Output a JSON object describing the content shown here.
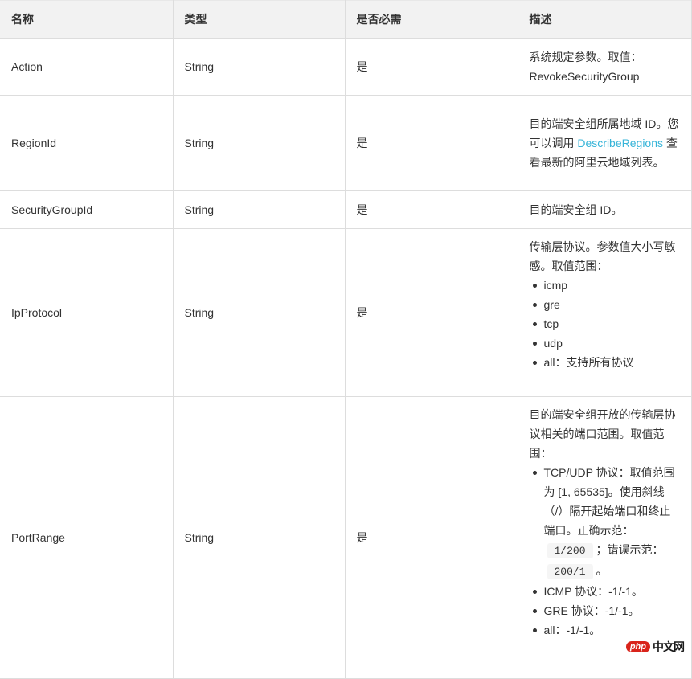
{
  "table": {
    "headers": [
      "名称",
      "类型",
      "是否必需",
      "描述"
    ],
    "rows": [
      {
        "name": "Action",
        "type": "String",
        "required": "是",
        "description": {
          "text": "系统规定参数。取值：RevokeSecurityGroup"
        }
      },
      {
        "name": "RegionId",
        "type": "String",
        "required": "是",
        "description": {
          "text_before": "目的端安全组所属地域 ID。您可以调用 ",
          "link": "DescribeRegions",
          "text_after": " 查看最新的阿里云地域列表。"
        }
      },
      {
        "name": "SecurityGroupId",
        "type": "String",
        "required": "是",
        "description": {
          "text": "目的端安全组 ID。"
        }
      },
      {
        "name": "IpProtocol",
        "type": "String",
        "required": "是",
        "description": {
          "intro": "传输层协议。参数值大小写敏感。取值范围：",
          "options": [
            "icmp",
            "gre",
            "tcp",
            "udp",
            "all：支持所有协议"
          ]
        }
      },
      {
        "name": "PortRange",
        "type": "String",
        "required": "是",
        "description": {
          "intro": "目的端安全组开放的传输层协议相关的端口范围。取值范围：",
          "tcp_udp": {
            "text_before": "TCP/UDP 协议：取值范围为 [1, 65535]。使用斜线（/）隔开起始端口和终止端口。正确示范：",
            "correct_example": "1/200",
            "text_middle": "；错误示范：",
            "wrong_example": "200/1",
            "text_after": "。"
          },
          "options": [
            "ICMP 协议：-1/-1。",
            "GRE 协议：-1/-1。",
            "all：-1/-1。"
          ]
        }
      }
    ]
  },
  "watermark": {
    "logo": "php",
    "text": "中文网"
  },
  "colors": {
    "link": "#36b4d8",
    "header_bg": "#f2f2f2",
    "border": "#dddddd",
    "text": "#333333"
  }
}
